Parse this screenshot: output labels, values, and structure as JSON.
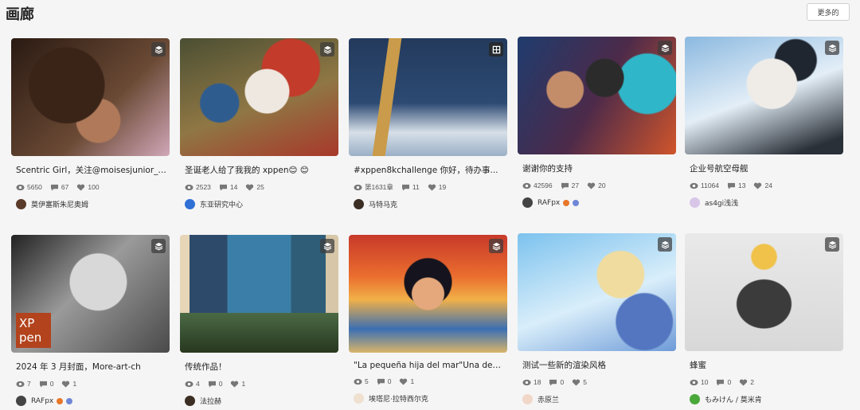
{
  "page": {
    "title": "画廊",
    "more_label": "更多的"
  },
  "colors": {
    "accent": "#1a73e8",
    "badge_bg": "#3c3c3c"
  },
  "icons": {
    "badge": "layers-icon",
    "badge_alt": "frames-icon",
    "views": "eye-icon",
    "comments": "comment-icon",
    "likes": "heart-icon"
  },
  "cards": [
    {
      "title": "Scentric Girl，关注@moisesjunior_mj...",
      "views": "5650",
      "comments": "67",
      "likes": "100",
      "author": "莫伊塞斯朱尼奥姆"
    },
    {
      "title": "圣诞老人给了我我的 xppen😊 😊",
      "views": "2523",
      "comments": "14",
      "likes": "25",
      "author": "东亚研究中心"
    },
    {
      "title": "#xppen8kchallenge 你好，待办事...",
      "views": "第1631章",
      "comments": "11",
      "likes": "19",
      "author": "马特马克"
    },
    {
      "title": "谢谢你的支持",
      "views": "42596",
      "comments": "27",
      "likes": "20",
      "author": "RAFpx"
    },
    {
      "title": "企业号航空母舰",
      "views": "11064",
      "comments": "13",
      "likes": "24",
      "author": "as4gi浅浅"
    },
    {
      "title": "2024 年 3 月封面，More-art-ch",
      "views": "7",
      "comments": "0",
      "likes": "1",
      "author": "RAFpx",
      "thumb_text": "XP pen"
    },
    {
      "title": "传统作品！",
      "views": "4",
      "comments": "0",
      "likes": "1",
      "author": "法拉赫"
    },
    {
      "title": "\"La pequeña hija del mar\"Una demi...",
      "views": "5",
      "comments": "0",
      "likes": "1",
      "author": "埃塔尼·拉特西尔克"
    },
    {
      "title": "测试一些新的渲染风格",
      "views": "18",
      "comments": "0",
      "likes": "5",
      "author": "赤原兰"
    },
    {
      "title": "蜂蜜",
      "views": "10",
      "comments": "0",
      "likes": "2",
      "author": "もみけん / 莫米肯"
    }
  ]
}
